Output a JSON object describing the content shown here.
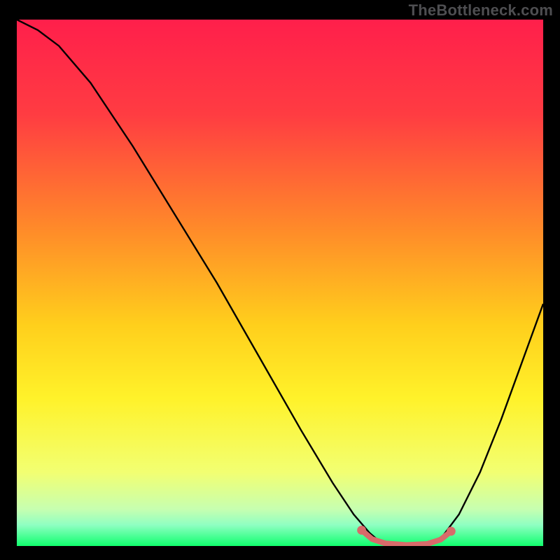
{
  "attribution": "TheBottleneck.com",
  "chart_data": {
    "type": "line",
    "title": "",
    "xlabel": "",
    "ylabel": "",
    "xlim": [
      0,
      100
    ],
    "ylim": [
      0,
      100
    ],
    "gradient_stops": [
      {
        "offset": 0,
        "color": "#ff1f4b"
      },
      {
        "offset": 18,
        "color": "#ff3c42"
      },
      {
        "offset": 40,
        "color": "#ff8b29"
      },
      {
        "offset": 58,
        "color": "#ffcf1c"
      },
      {
        "offset": 72,
        "color": "#fff22a"
      },
      {
        "offset": 86,
        "color": "#f2ff72"
      },
      {
        "offset": 93,
        "color": "#c7ffb0"
      },
      {
        "offset": 96,
        "color": "#8fffc2"
      },
      {
        "offset": 99,
        "color": "#2fff83"
      },
      {
        "offset": 100,
        "color": "#11ff6c"
      }
    ],
    "series": [
      {
        "name": "bottleneck-curve",
        "stroke": "#000000",
        "points": [
          {
            "x": 0,
            "y": 100
          },
          {
            "x": 4,
            "y": 98
          },
          {
            "x": 8,
            "y": 95
          },
          {
            "x": 14,
            "y": 88
          },
          {
            "x": 22,
            "y": 76
          },
          {
            "x": 30,
            "y": 63
          },
          {
            "x": 38,
            "y": 50
          },
          {
            "x": 46,
            "y": 36
          },
          {
            "x": 54,
            "y": 22
          },
          {
            "x": 60,
            "y": 12
          },
          {
            "x": 64,
            "y": 6
          },
          {
            "x": 67,
            "y": 2.5
          },
          {
            "x": 69,
            "y": 0.8
          },
          {
            "x": 72,
            "y": 0.2
          },
          {
            "x": 76,
            "y": 0.2
          },
          {
            "x": 79,
            "y": 0.6
          },
          {
            "x": 81,
            "y": 2
          },
          {
            "x": 84,
            "y": 6
          },
          {
            "x": 88,
            "y": 14
          },
          {
            "x": 92,
            "y": 24
          },
          {
            "x": 96,
            "y": 35
          },
          {
            "x": 100,
            "y": 46
          }
        ]
      },
      {
        "name": "flat-region-highlight",
        "stroke": "#d86a6a",
        "stroke_width_px": 8,
        "points": [
          {
            "x": 65.5,
            "y": 3.0
          },
          {
            "x": 67.5,
            "y": 1.3
          },
          {
            "x": 70,
            "y": 0.5
          },
          {
            "x": 74,
            "y": 0.2
          },
          {
            "x": 78,
            "y": 0.4
          },
          {
            "x": 80.5,
            "y": 1.2
          },
          {
            "x": 82.5,
            "y": 2.8
          }
        ],
        "endpoint_dots": [
          {
            "x": 65.5,
            "y": 3.0
          },
          {
            "x": 82.5,
            "y": 2.8
          }
        ]
      }
    ]
  }
}
